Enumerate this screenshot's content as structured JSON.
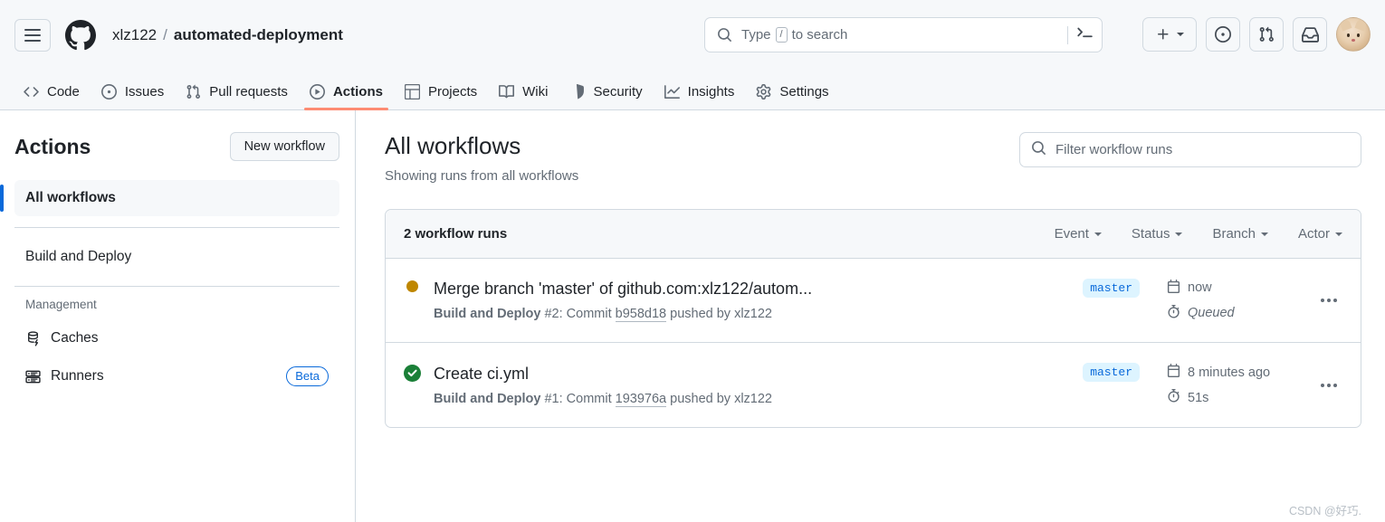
{
  "header": {
    "menu_icon": "hamburger-menu-icon",
    "logo_icon": "github-logo-icon",
    "breadcrumb": {
      "owner": "xlz122",
      "separator": "/",
      "repo": "automated-deployment"
    },
    "search": {
      "icon": "search-icon",
      "placeholder_before": "Type",
      "slash_key": "/",
      "placeholder_after": "to search",
      "terminal_icon": "command-palette-terminal-icon"
    },
    "actions": {
      "create_new_icon": "plus-icon",
      "create_new_caret": "chevron-down-icon",
      "issues_icon": "issue-opened-icon",
      "pull_requests_icon": "git-pull-request-icon",
      "inbox_icon": "inbox-icon",
      "avatar": "user-avatar"
    }
  },
  "repo_nav": {
    "items": [
      {
        "label": "Code",
        "icon": "code-icon",
        "active": false
      },
      {
        "label": "Issues",
        "icon": "issue-opened-icon",
        "active": false
      },
      {
        "label": "Pull requests",
        "icon": "git-pull-request-icon",
        "active": false
      },
      {
        "label": "Actions",
        "icon": "play-circle-icon",
        "active": true
      },
      {
        "label": "Projects",
        "icon": "table-icon",
        "active": false
      },
      {
        "label": "Wiki",
        "icon": "book-icon",
        "active": false
      },
      {
        "label": "Security",
        "icon": "shield-icon",
        "active": false
      },
      {
        "label": "Insights",
        "icon": "graph-icon",
        "active": false
      },
      {
        "label": "Settings",
        "icon": "gear-icon",
        "active": false
      }
    ]
  },
  "sidebar": {
    "title": "Actions",
    "new_workflow_button": "New workflow",
    "all_workflows": "All workflows",
    "workflows": [
      {
        "label": "Build and Deploy"
      }
    ],
    "management_label": "Management",
    "management_items": [
      {
        "label": "Caches",
        "icon": "cache-database-icon",
        "badge": ""
      },
      {
        "label": "Runners",
        "icon": "server-rack-icon",
        "badge": "Beta"
      }
    ]
  },
  "main": {
    "title": "All workflows",
    "subtitle": "Showing runs from all workflows",
    "filter": {
      "icon": "search-icon",
      "placeholder": "Filter workflow runs"
    },
    "runs_header": {
      "count_label": "2 workflow runs",
      "filters": [
        {
          "label": "Event"
        },
        {
          "label": "Status"
        },
        {
          "label": "Branch"
        },
        {
          "label": "Actor"
        }
      ]
    },
    "runs": [
      {
        "status_icon": "status-queued-dot-icon",
        "status": "queued",
        "title": "Merge branch 'master' of github.com:xlz122/autom...",
        "workflow_name": "Build and Deploy",
        "run_number": "#2:",
        "commit_word": "Commit",
        "commit_sha": "b958d18",
        "pushed_by": "pushed by xlz122",
        "branch": "master",
        "date_icon": "calendar-icon",
        "date": "now",
        "duration_icon": "stopwatch-icon",
        "duration": "Queued",
        "duration_italic": true,
        "kebab_icon": "kebab-horizontal-icon"
      },
      {
        "status_icon": "status-success-check-icon",
        "status": "success",
        "title": "Create ci.yml",
        "workflow_name": "Build and Deploy",
        "run_number": "#1:",
        "commit_word": "Commit",
        "commit_sha": "193976a",
        "pushed_by": "pushed by xlz122",
        "branch": "master",
        "date_icon": "calendar-icon",
        "date": "8 minutes ago",
        "duration_icon": "stopwatch-icon",
        "duration": "51s",
        "duration_italic": false,
        "kebab_icon": "kebab-horizontal-icon"
      }
    ]
  },
  "watermark": "CSDN @好巧.",
  "colors": {
    "accent_blue": "#0969da",
    "active_tab_underline": "#fd8c73",
    "status_queued": "#bf8700",
    "status_success": "#1a7f37",
    "branch_badge_bg": "#ddf4ff",
    "border": "#d1d9e0",
    "canvas_subtle": "#f6f8fa"
  }
}
